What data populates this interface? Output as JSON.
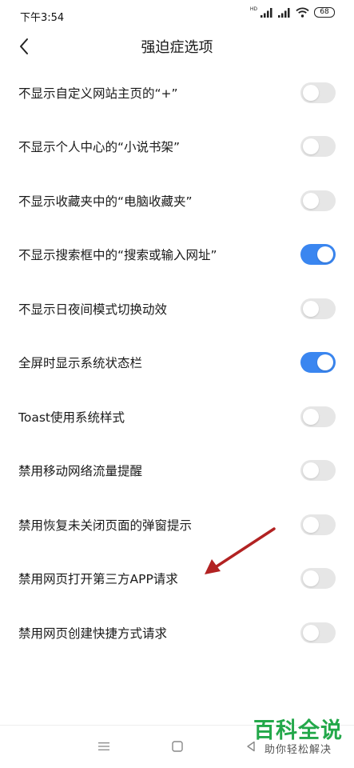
{
  "status_bar": {
    "time": "下午3:54",
    "hd_label": "HD",
    "battery": "68"
  },
  "header": {
    "title": "强迫症选项"
  },
  "settings": [
    {
      "label": "不显示自定义网站主页的“+”",
      "enabled": false
    },
    {
      "label": "不显示个人中心的“小说书架”",
      "enabled": false
    },
    {
      "label": "不显示收藏夹中的“电脑收藏夹”",
      "enabled": false
    },
    {
      "label": "不显示搜索框中的“搜索或输入网址”",
      "enabled": true
    },
    {
      "label": "不显示日夜间模式切换动效",
      "enabled": false
    },
    {
      "label": "全屏时显示系统状态栏",
      "enabled": true
    },
    {
      "label": "Toast使用系统样式",
      "enabled": false
    },
    {
      "label": "禁用移动网络流量提醒",
      "enabled": false
    },
    {
      "label": "禁用恢复未关闭页面的弹窗提示",
      "enabled": false
    },
    {
      "label": "禁用网页打开第三方APP请求",
      "enabled": false
    },
    {
      "label": "禁用网页创建快捷方式请求",
      "enabled": false
    }
  ],
  "watermark": {
    "title": "百科全说",
    "subtitle": "助你轻松解决"
  },
  "colors": {
    "toggle_on": "#3a86f0",
    "toggle_off": "#e6e6e6",
    "arrow": "#b22222",
    "watermark": "#23a84a"
  }
}
